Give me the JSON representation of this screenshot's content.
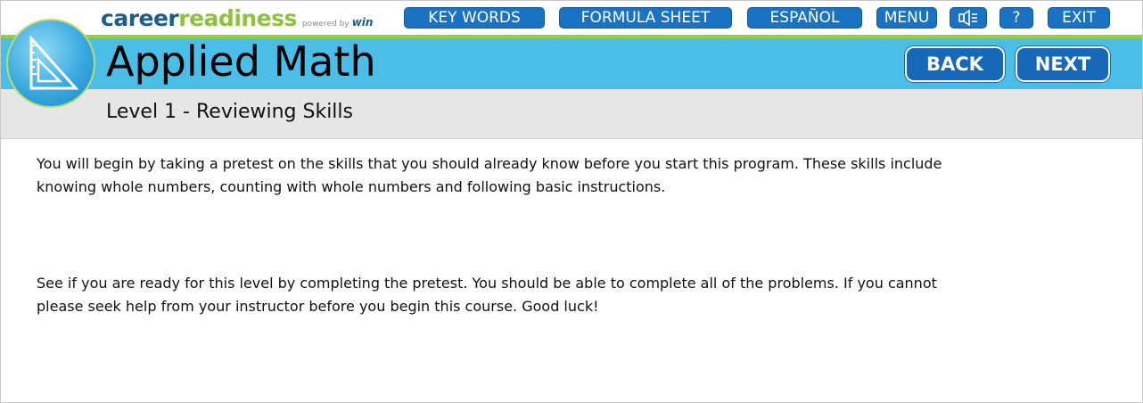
{
  "brand": {
    "part1": "career",
    "part2": "readiness",
    "powered_by": "powered by",
    "partner": "win"
  },
  "nav": {
    "key_words": "KEY WORDS",
    "formula_sheet": "FORMULA SHEET",
    "espanol": "ESPAÑOL",
    "menu": "MENU",
    "help": "?",
    "exit": "EXIT"
  },
  "header": {
    "title": "Applied Math",
    "back": "BACK",
    "next": "NEXT"
  },
  "subheader": {
    "title": "Level 1 - Reviewing Skills"
  },
  "content": {
    "paragraph1_line1": "You will begin by taking a pretest on the skills that you should already know before you start this program. These skills include",
    "paragraph1_line2": "knowing whole numbers, counting with whole numbers and following basic instructions.",
    "paragraph2_line1": "See if you are ready for this level by completing the pretest. You should be able to complete all of the problems. If you cannot",
    "paragraph2_line2": "please seek help from your instructor before you begin this course. Good luck!"
  },
  "icons": {
    "logo": "triangle-ruler-icon",
    "audio": "speaker-icon"
  },
  "colors": {
    "nav_button": "#1a72c2",
    "title_band": "#4bbee8",
    "accent_green": "#9acd3c",
    "sub_band": "#e6e6e6"
  }
}
